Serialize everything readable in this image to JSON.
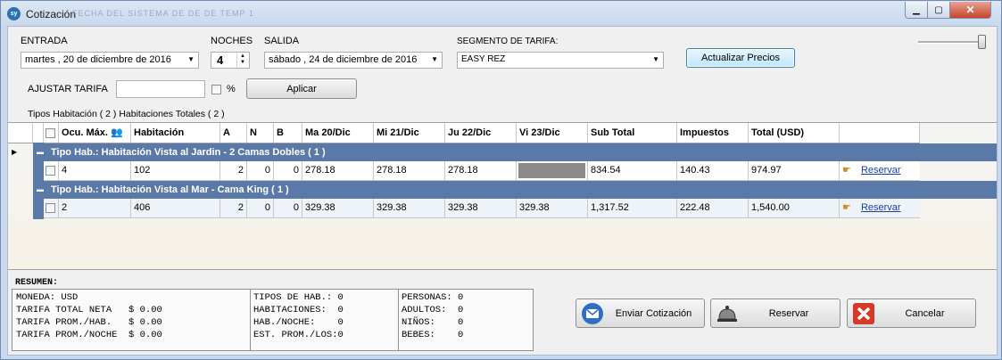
{
  "window": {
    "title": "Cotización",
    "app_badge": "sy",
    "ghost_text": "FECHA DEL SISTEMA   DE DE DE   TEMP 1"
  },
  "form": {
    "entrada_label": "ENTRADA",
    "entrada_value": "martes   , 20 de  diciembre de 2016",
    "noches_label": "NOCHES",
    "noches_value": "4",
    "salida_label": "SALIDA",
    "salida_value": "sábado  , 24 de  diciembre de 2016",
    "segmento_label": "SEGMENTO DE TARIFA:",
    "segmento_value": "EASY REZ",
    "actualizar_label": "Actualizar Precios",
    "ajustar_label": "AJUSTAR TARIFA",
    "ajustar_value": "",
    "percent_label": "%",
    "aplicar_label": "Aplicar",
    "summary_line": "Tipos Habitación ( 2 ) Habitaciones Totales ( 2 )"
  },
  "grid": {
    "headers": [
      "Ocu. Máx.",
      "Habitación",
      "A",
      "N",
      "B",
      "Ma 20/Dic",
      "Mi 21/Dic",
      "Ju 22/Dic",
      "Vi 23/Dic",
      "Sub Total",
      "Impuestos",
      "Total (USD)"
    ],
    "groups": [
      {
        "title": "Tipo Hab.: Habitación Vista al Jardin - 2 Camas Dobles ( 1 )",
        "row": {
          "ocu": "4",
          "hab": "102",
          "a": "2",
          "n": "0",
          "b": "0",
          "d1": "278.18",
          "d2": "278.18",
          "d3": "278.18",
          "d4": "",
          "d4_blocked": true,
          "sub": "834.54",
          "imp": "140.43",
          "total": "974.97",
          "action": "Reservar"
        }
      },
      {
        "title": "Tipo Hab.: Habitación Vista al Mar - Cama King ( 1 )",
        "row": {
          "ocu": "2",
          "hab": "406",
          "a": "2",
          "n": "0",
          "b": "0",
          "d1": "329.38",
          "d2": "329.38",
          "d3": "329.38",
          "d4": "329.38",
          "d4_blocked": false,
          "sub": "1,317.52",
          "imp": "222.48",
          "total": "1,540.00",
          "action": "Reservar"
        }
      }
    ]
  },
  "resumen": {
    "title": "RESUMEN:",
    "col1": "MONEDA: USD\nTARIFA TOTAL NETA   $ 0.00\nTARIFA PROM./HAB.   $ 0.00\nTARIFA PROM./NOCHE  $ 0.00",
    "col2": "TIPOS DE HAB.: 0\nHABITACIONES:  0\nHAB./NOCHE:    0\nEST. PROM./LOS:0",
    "col3": "PERSONAS: 0\nADULTOS:  0\nNIÑOS:    0\nBEBES:    0"
  },
  "actions": {
    "enviar": "Enviar Cotización",
    "reservar": "Reservar",
    "cancelar": "Cancelar"
  },
  "colors": {
    "group_bar": "#5b79a8",
    "link": "#1a3fa8",
    "close": "#c7432c"
  }
}
